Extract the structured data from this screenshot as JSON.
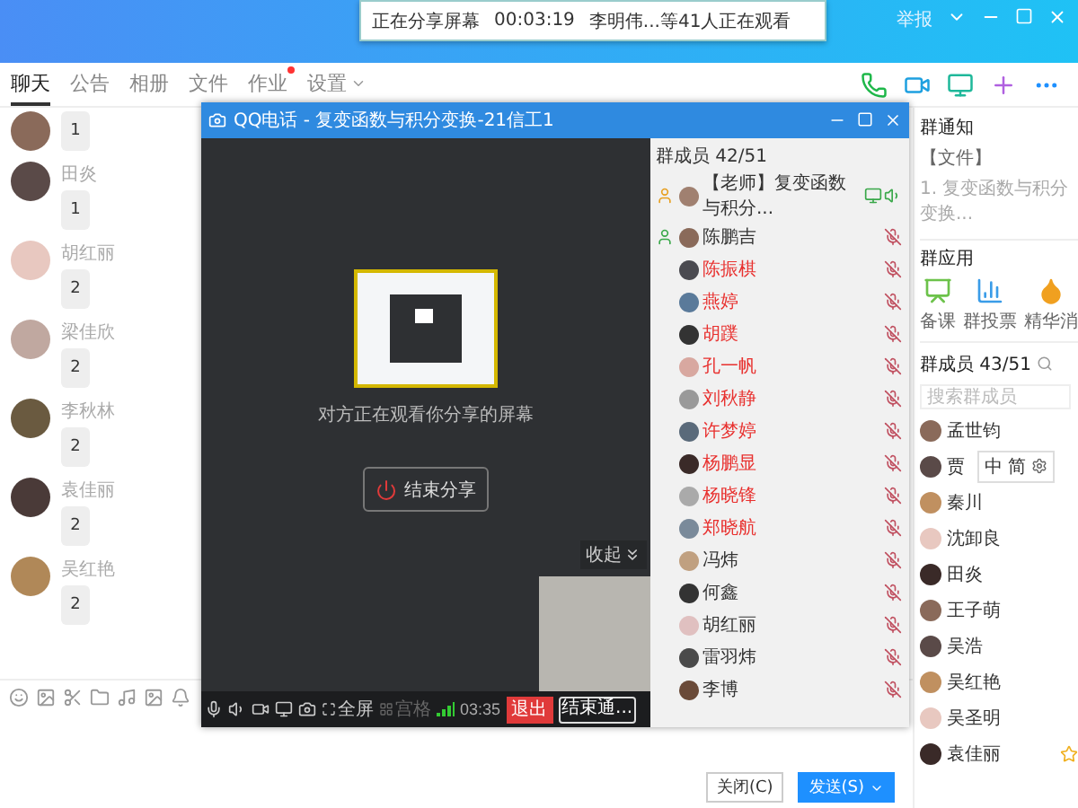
{
  "share_notice": {
    "status": "正在分享屏幕",
    "time": "00:03:19",
    "viewers": "李明伟...等41人正在观看"
  },
  "window_bar": {
    "report": "举报"
  },
  "tabs": [
    {
      "label": "聊天",
      "selected": true,
      "badge": false,
      "dropdown": false
    },
    {
      "label": "公告",
      "selected": false,
      "badge": false,
      "dropdown": false
    },
    {
      "label": "相册",
      "selected": false,
      "badge": false,
      "dropdown": false
    },
    {
      "label": "文件",
      "selected": false,
      "badge": false,
      "dropdown": false
    },
    {
      "label": "作业",
      "selected": false,
      "badge": true,
      "dropdown": false
    },
    {
      "label": "设置",
      "selected": false,
      "badge": false,
      "dropdown": true
    }
  ],
  "chat": {
    "messages": [
      {
        "text": "1"
      },
      {
        "name": "田炎",
        "text": "1"
      },
      {
        "name": "胡红丽",
        "text": "2"
      },
      {
        "name": "梁佳欣",
        "text": "2"
      },
      {
        "name": "李秋林",
        "text": "2"
      },
      {
        "name": "袁佳丽",
        "text": "2"
      },
      {
        "name": "吴红艳",
        "text": "2"
      }
    ]
  },
  "composer": {
    "close": "关闭(C)",
    "send": "发送(S)"
  },
  "call": {
    "title": "QQ电话 - 复变函数与积分变换-21信工1",
    "share_hint": "对方正在观看你分享的屏幕",
    "end_share": "结束分享",
    "collapse": "收起",
    "toolbar": {
      "fullscreen": "全屏",
      "grid": "宫格",
      "grid_disabled": true,
      "time": "03:35",
      "exit": "退出",
      "end_call": "结束通..."
    },
    "members_header": "群成员 42/51",
    "members": [
      {
        "name": "【老师】复变函数与积分...",
        "kind": "teacher",
        "muted": false,
        "color": "#333333"
      },
      {
        "name": "陈鹏吉",
        "kind": "admin",
        "muted": true,
        "color": "#333333"
      },
      {
        "name": "陈振棋",
        "kind": "member",
        "muted": true,
        "color": "#e8302e"
      },
      {
        "name": "燕婷",
        "kind": "member",
        "muted": true,
        "color": "#e8302e"
      },
      {
        "name": "胡蹼",
        "kind": "member",
        "muted": true,
        "color": "#e8302e"
      },
      {
        "name": "孔一帆",
        "kind": "member",
        "muted": true,
        "color": "#e8302e"
      },
      {
        "name": "刘秋静",
        "kind": "member",
        "muted": true,
        "color": "#e8302e"
      },
      {
        "name": "许梦婷",
        "kind": "member",
        "muted": true,
        "color": "#e8302e"
      },
      {
        "name": "杨鹏显",
        "kind": "member",
        "muted": true,
        "color": "#e8302e"
      },
      {
        "name": "杨晓锋",
        "kind": "member",
        "muted": true,
        "color": "#e8302e"
      },
      {
        "name": "郑晓航",
        "kind": "member",
        "muted": true,
        "color": "#e8302e"
      },
      {
        "name": "冯炜",
        "kind": "member",
        "muted": true,
        "color": "#333333"
      },
      {
        "name": "何鑫",
        "kind": "member",
        "muted": true,
        "color": "#333333"
      },
      {
        "name": "胡红丽",
        "kind": "member",
        "muted": true,
        "color": "#333333"
      },
      {
        "name": "雷羽炜",
        "kind": "member",
        "muted": true,
        "color": "#333333"
      },
      {
        "name": "李博",
        "kind": "member",
        "muted": true,
        "color": "#333333"
      }
    ]
  },
  "side": {
    "notice_title": "群通知",
    "notice_tag": "【文件】",
    "notice_text": "1. 复变函数与积分变换...",
    "apps_title": "群应用",
    "apps": [
      {
        "label": "备课",
        "kind": "lesson"
      },
      {
        "label": "群投票",
        "kind": "vote"
      },
      {
        "label": "精华消",
        "kind": "essence"
      }
    ],
    "members_title": "群成员 43/51",
    "search_placeholder": "搜索群成员",
    "members": [
      {
        "name": "孟世钧",
        "star": false
      },
      {
        "name": "贾",
        "star": false
      },
      {
        "name": "秦川",
        "star": false
      },
      {
        "name": "沈卸良",
        "star": false
      },
      {
        "name": "田炎",
        "star": false
      },
      {
        "name": "王子萌",
        "star": false
      },
      {
        "name": "吴浩",
        "star": false
      },
      {
        "name": "吴红艳",
        "star": false
      },
      {
        "name": "吴圣明",
        "star": false
      },
      {
        "name": "袁佳丽",
        "star": true
      }
    ],
    "ime": [
      "中",
      "简"
    ]
  }
}
